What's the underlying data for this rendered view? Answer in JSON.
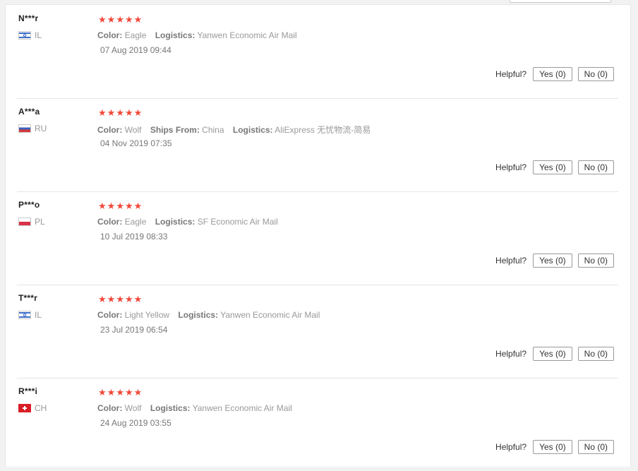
{
  "reviews": [
    {
      "user": "N***r",
      "country": "IL",
      "rating": 5,
      "meta": [
        {
          "label": "Color:",
          "value": "Eagle"
        },
        {
          "label": "Logistics:",
          "value": "Yanwen Economic Air Mail"
        }
      ],
      "date": "07 Aug 2019 09:44",
      "helpful_label": "Helpful?",
      "yes_label": "Yes (0)",
      "no_label": "No (0)"
    },
    {
      "user": "A***a",
      "country": "RU",
      "rating": 5,
      "meta": [
        {
          "label": "Color:",
          "value": "Wolf"
        },
        {
          "label": "Ships From:",
          "value": "China"
        },
        {
          "label": "Logistics:",
          "value": "AliExpress 无忧物流-简易"
        }
      ],
      "date": "04 Nov 2019 07:35",
      "helpful_label": "Helpful?",
      "yes_label": "Yes (0)",
      "no_label": "No (0)"
    },
    {
      "user": "P***o",
      "country": "PL",
      "rating": 5,
      "meta": [
        {
          "label": "Color:",
          "value": "Eagle"
        },
        {
          "label": "Logistics:",
          "value": "SF Economic Air Mail"
        }
      ],
      "date": "10 Jul 2019 08:33",
      "helpful_label": "Helpful?",
      "yes_label": "Yes (0)",
      "no_label": "No (0)"
    },
    {
      "user": "T***r",
      "country": "IL",
      "rating": 5,
      "meta": [
        {
          "label": "Color:",
          "value": "Light Yellow"
        },
        {
          "label": "Logistics:",
          "value": "Yanwen Economic Air Mail"
        }
      ],
      "date": "23 Jul 2019 06:54",
      "helpful_label": "Helpful?",
      "yes_label": "Yes (0)",
      "no_label": "No (0)"
    },
    {
      "user": "R***i",
      "country": "CH",
      "rating": 5,
      "meta": [
        {
          "label": "Color:",
          "value": "Wolf"
        },
        {
          "label": "Logistics:",
          "value": "Yanwen Economic Air Mail"
        }
      ],
      "date": "24 Aug 2019 03:55",
      "helpful_label": "Helpful?",
      "yes_label": "Yes (0)",
      "no_label": "No (0)"
    }
  ],
  "icons": {
    "star": "star-icon",
    "flag": "country-flag-icon"
  },
  "colors": {
    "star": "#f1483a",
    "muted_text": "#999999",
    "border": "#e5e5e5"
  }
}
